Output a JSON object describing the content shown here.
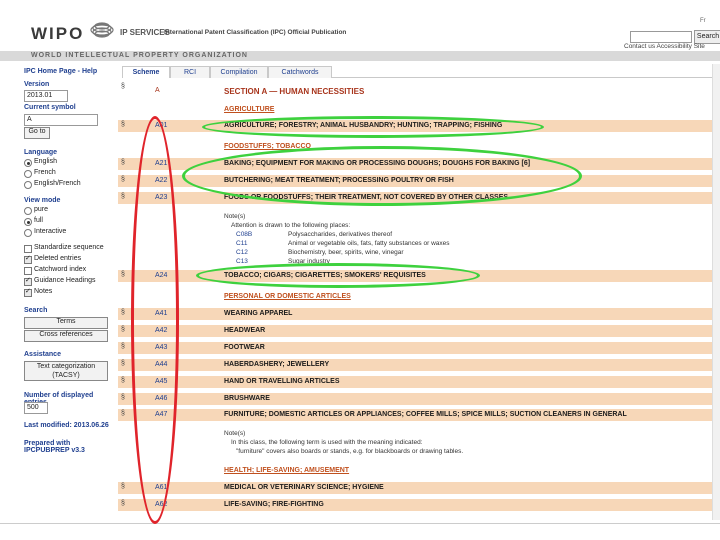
{
  "header": {
    "logo_text": "WIPO",
    "ip_services": "IP SERVICES",
    "publication_title": "International Patent Classification (IPC) Official Publication",
    "search_label": "Search",
    "top_links": "Contact us   Accessibility   Site",
    "org_name": "WORLD INTELLECTUAL PROPERTY ORGANIZATION"
  },
  "sidebar": {
    "nav": "IPC Home Page  -  Help",
    "version_label": "Version",
    "version_value": "2013.01",
    "current_symbol_label": "Current symbol",
    "current_symbol_value": "A",
    "go_button": "Go to",
    "language_label": "Language",
    "languages": [
      "English",
      "French",
      "English/French"
    ],
    "view_mode_label": "View mode",
    "view_modes": [
      "pure",
      "full",
      "Interactive"
    ],
    "options": [
      "Standardize sequence",
      "Deleted entries",
      "Catchword index",
      "Guidance Headings",
      "Notes"
    ],
    "search_label": "Search",
    "terms_button": "Terms",
    "cross_ref_button": "Cross references",
    "assistance_label": "Assistance",
    "text_cat_button": "Text categorization (TACSY)",
    "displayed_entries_label": "Number of displayed entries",
    "displayed_entries_value": "500",
    "last_modified": "Last modified: 2013.06.26",
    "prepared_with": "Prepared with IPCPUBPREP v3.3"
  },
  "tabs": [
    "Scheme",
    "RCI",
    "Compilation",
    "Catchwords"
  ],
  "section": {
    "code": "A",
    "title": "SECTION A — HUMAN NECESSITIES"
  },
  "subheadings": {
    "agriculture": "AGRICULTURE",
    "foodstuffs": "FOODSTUFFS; TOBACCO",
    "personal": "PERSONAL OR DOMESTIC ARTICLES",
    "health": "HEALTH; LIFE-SAVING; AMUSEMENT"
  },
  "rows": [
    {
      "code": "A01",
      "title": "AGRICULTURE; FORESTRY; ANIMAL HUSBANDRY; HUNTING; TRAPPING; FISHING"
    },
    {
      "code": "A21",
      "title": "BAKING; EQUIPMENT FOR MAKING OR PROCESSING DOUGHS; DOUGHS FOR BAKING [6]"
    },
    {
      "code": "A22",
      "title": "BUTCHERING; MEAT TREATMENT; PROCESSING POULTRY OR FISH"
    },
    {
      "code": "A23",
      "title": "FOODS OR FOODSTUFFS; THEIR TREATMENT, NOT COVERED BY OTHER CLASSES"
    },
    {
      "code": "A24",
      "title": "TOBACCO; CIGARS; CIGARETTES; SMOKERS' REQUISITES"
    },
    {
      "code": "A41",
      "title": "WEARING APPAREL"
    },
    {
      "code": "A42",
      "title": "HEADWEAR"
    },
    {
      "code": "A43",
      "title": "FOOTWEAR"
    },
    {
      "code": "A44",
      "title": "HABERDASHERY; JEWELLERY"
    },
    {
      "code": "A45",
      "title": "HAND OR TRAVELLING ARTICLES"
    },
    {
      "code": "A46",
      "title": "BRUSHWARE"
    },
    {
      "code": "A47",
      "title": "FURNITURE; DOMESTIC ARTICLES OR APPLIANCES; COFFEE MILLS; SPICE MILLS; SUCTION CLEANERS IN GENERAL"
    },
    {
      "code": "A61",
      "title": "MEDICAL OR VETERINARY SCIENCE; HYGIENE"
    },
    {
      "code": "A62",
      "title": "LIFE-SAVING; FIRE-FIGHTING"
    }
  ],
  "notes_a23": {
    "heading": "Note(s)",
    "intro": "Attention is drawn to the following places:",
    "items": [
      {
        "code": "C08B",
        "text": "Polysaccharides, derivatives thereof"
      },
      {
        "code": "C11",
        "text": "Animal or vegetable oils, fats, fatty substances or waxes"
      },
      {
        "code": "C12",
        "text": "Biochemistry, beer, spirits, wine, vinegar"
      },
      {
        "code": "C13",
        "text": "Sugar industry"
      }
    ]
  },
  "notes_a47": {
    "heading": "Note(s)",
    "line1": "In this class, the following term is used with the meaning indicated:",
    "line2": "\"furniture\" covers also boards or stands, e.g. for blackboards or drawing tables."
  },
  "row_icon": "§",
  "annotation_colors": {
    "green": "#3ed13e",
    "red": "#e0242b"
  }
}
